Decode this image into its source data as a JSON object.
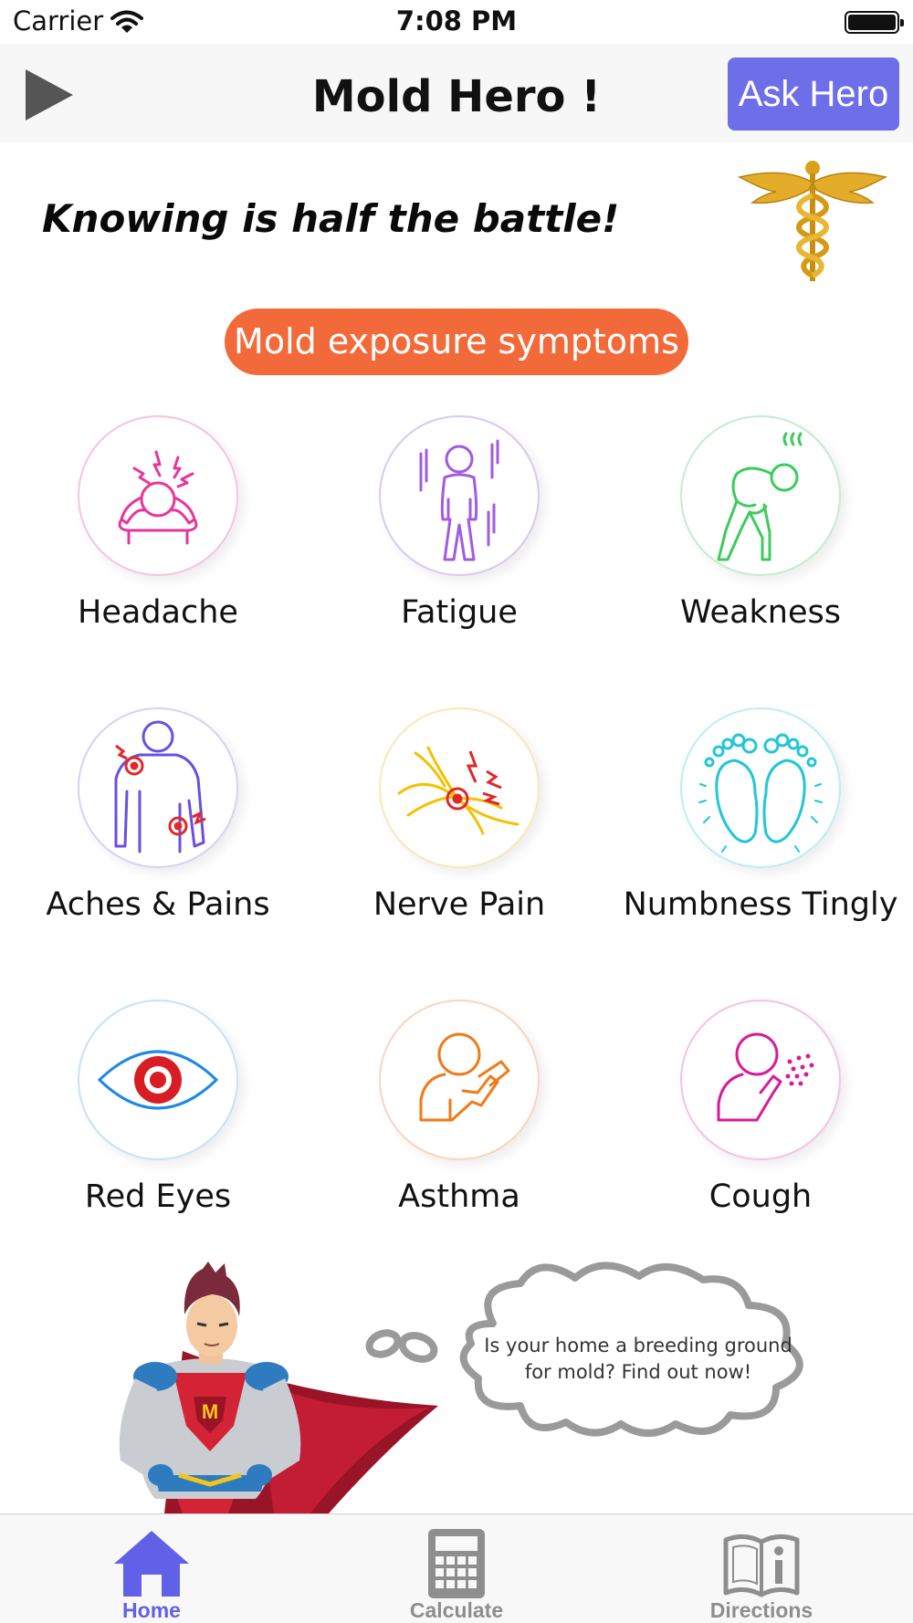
{
  "status_bar": {
    "carrier": "Carrier",
    "time": "7:08 PM"
  },
  "nav": {
    "title": "Mold Hero !",
    "ask_button": "Ask Hero",
    "play_icon": "play-icon"
  },
  "tagline": "Knowing is half the battle!",
  "section_button": "Mold exposure symptoms",
  "symptoms": [
    {
      "label": "Headache",
      "icon": "headache-icon",
      "color": "#e8359a"
    },
    {
      "label": "Fatigue",
      "icon": "fatigue-icon",
      "color": "#a15be0"
    },
    {
      "label": "Weakness",
      "icon": "weakness-icon",
      "color": "#3ccb5c"
    },
    {
      "label": "Aches & Pains",
      "icon": "aches-icon",
      "color": "#6a4fe0"
    },
    {
      "label": "Nerve Pain",
      "icon": "nerve-icon",
      "color": "#f3c200"
    },
    {
      "label": "Numbness Tingly",
      "icon": "feet-icon",
      "color": "#22c7d6"
    },
    {
      "label": "Red Eyes",
      "icon": "eye-icon",
      "color": "#1e88e5"
    },
    {
      "label": "Asthma",
      "icon": "inhaler-icon",
      "color": "#f07a17"
    },
    {
      "label": "Cough",
      "icon": "cough-icon",
      "color": "#d81b9a"
    }
  ],
  "hero": {
    "thought": "Is your home a breeding ground for mold? Find out now!"
  },
  "tabs": [
    {
      "label": "Home",
      "icon": "home-icon",
      "active": true
    },
    {
      "label": "Calculate",
      "icon": "calculator-icon",
      "active": false
    },
    {
      "label": "Directions",
      "icon": "book-icon",
      "active": false
    }
  ],
  "colors": {
    "accent": "#6e6ee9",
    "pill": "#f26a3a",
    "tab_active": "#6161e8"
  }
}
